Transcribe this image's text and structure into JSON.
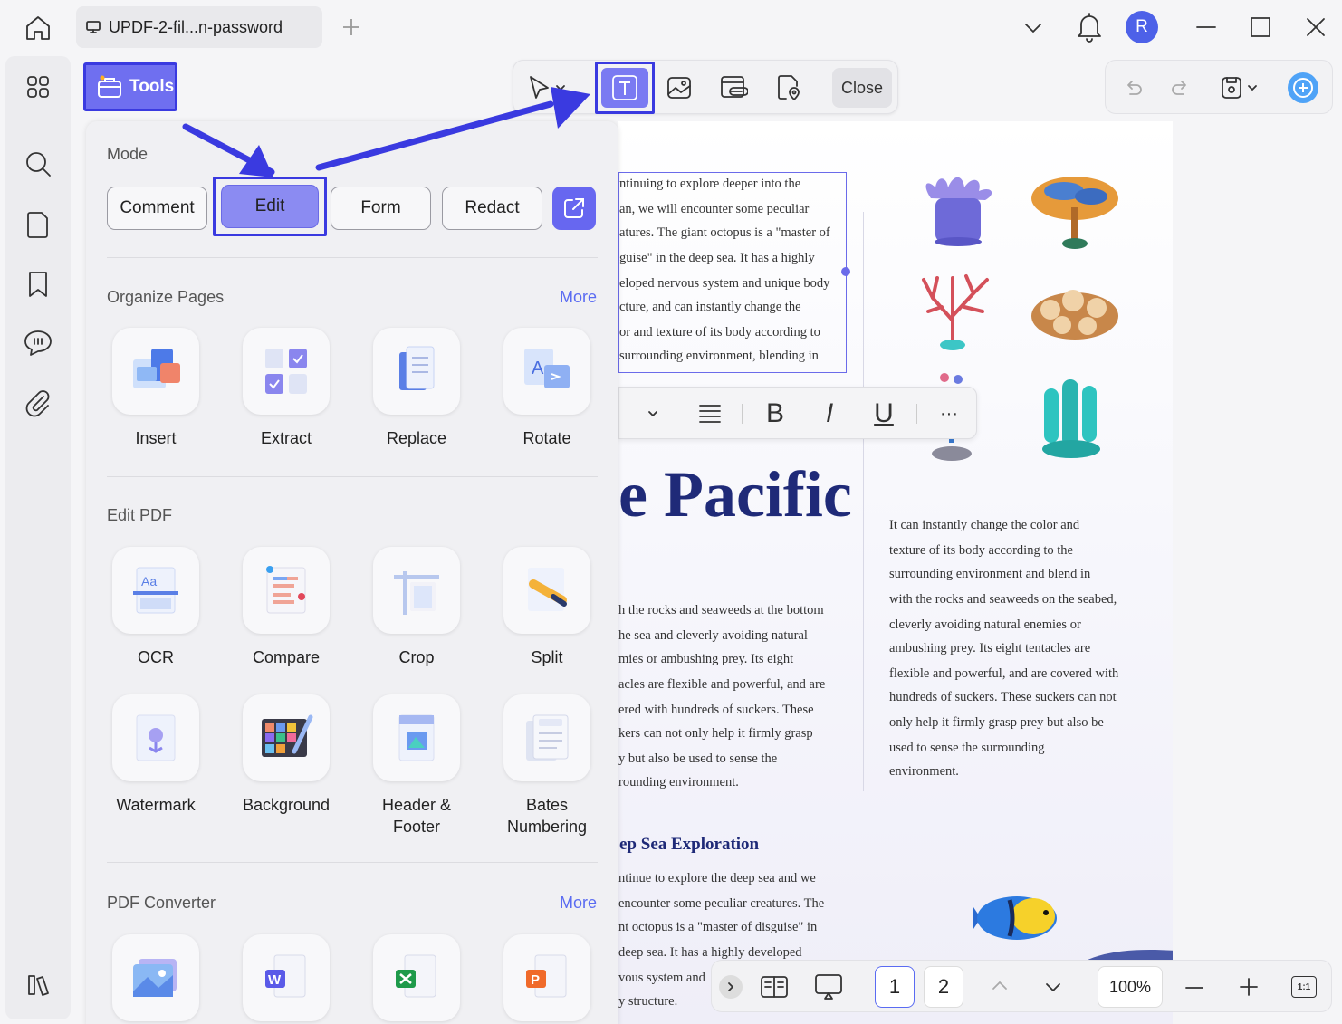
{
  "window": {
    "tab_title": "UPDF-2-fil...n-password",
    "avatar_initial": "R"
  },
  "tools_button": {
    "label": "Tools"
  },
  "toolbar": {
    "close_label": "Close"
  },
  "panel": {
    "mode": {
      "title": "Mode",
      "buttons": [
        "Comment",
        "Edit",
        "Form",
        "Redact"
      ],
      "selected": "Edit"
    },
    "organize": {
      "title": "Organize Pages",
      "more": "More",
      "tools": [
        "Insert",
        "Extract",
        "Replace",
        "Rotate"
      ]
    },
    "edit_pdf": {
      "title": "Edit PDF",
      "tools": [
        "OCR",
        "Compare",
        "Crop",
        "Split",
        "Watermark",
        "Background",
        "Header &",
        "Footer",
        "Bates",
        "Numbering"
      ]
    },
    "converter": {
      "title": "PDF Converter",
      "more": "More"
    }
  },
  "document": {
    "selected_text": [
      "ntinuing to explore deeper into the",
      "an, we will encounter some peculiar",
      "atures. The giant octopus is a \"master of",
      "guise\" in the deep sea. It has a highly",
      "eloped nervous system and unique body",
      "cture, and can instantly change the",
      "or and texture of its body according to",
      "surrounding environment, blending in"
    ],
    "big_title": "e Pacific",
    "left_column": [
      "h the rocks and seaweeds at the bottom",
      "he sea and cleverly avoiding natural",
      "mies or ambushing prey. Its eight",
      "acles are flexible and powerful, and are",
      "ered with hundreds of suckers. These",
      "kers can not only help it firmly grasp",
      "y but also be used to sense the",
      "rounding environment."
    ],
    "right_column": [
      "It can instantly change the color and",
      "texture of its body according to the",
      "surrounding environment and blend in",
      "with the rocks and seaweeds on the seabed,",
      "cleverly avoiding natural enemies or",
      "ambushing prey. Its eight tentacles are",
      "flexible and powerful, and are covered with",
      "hundreds of suckers. These suckers can not",
      "only help it firmly grasp prey but also be",
      "used to sense the surrounding",
      "environment."
    ],
    "subtitle": "ep Sea Exploration",
    "lower_column": [
      "ntinue to explore the deep sea and we",
      "encounter some peculiar creatures. The",
      "nt octopus is a \"master of disguise\" in",
      "deep sea. It has a highly developed",
      "vous system and",
      "y structure."
    ],
    "format_bar": {
      "bold": "B",
      "italic": "I",
      "underline": "U",
      "more": "···"
    }
  },
  "bottom_bar": {
    "pages": [
      "1",
      "2"
    ],
    "current_page": "1",
    "zoom": "100%",
    "fit_label": "1:1"
  },
  "colors": {
    "accent": "#6f6ff0",
    "annotation_blue": "#3a3ae0",
    "title_navy": "#1f2a78",
    "link": "#5a6bf2"
  }
}
